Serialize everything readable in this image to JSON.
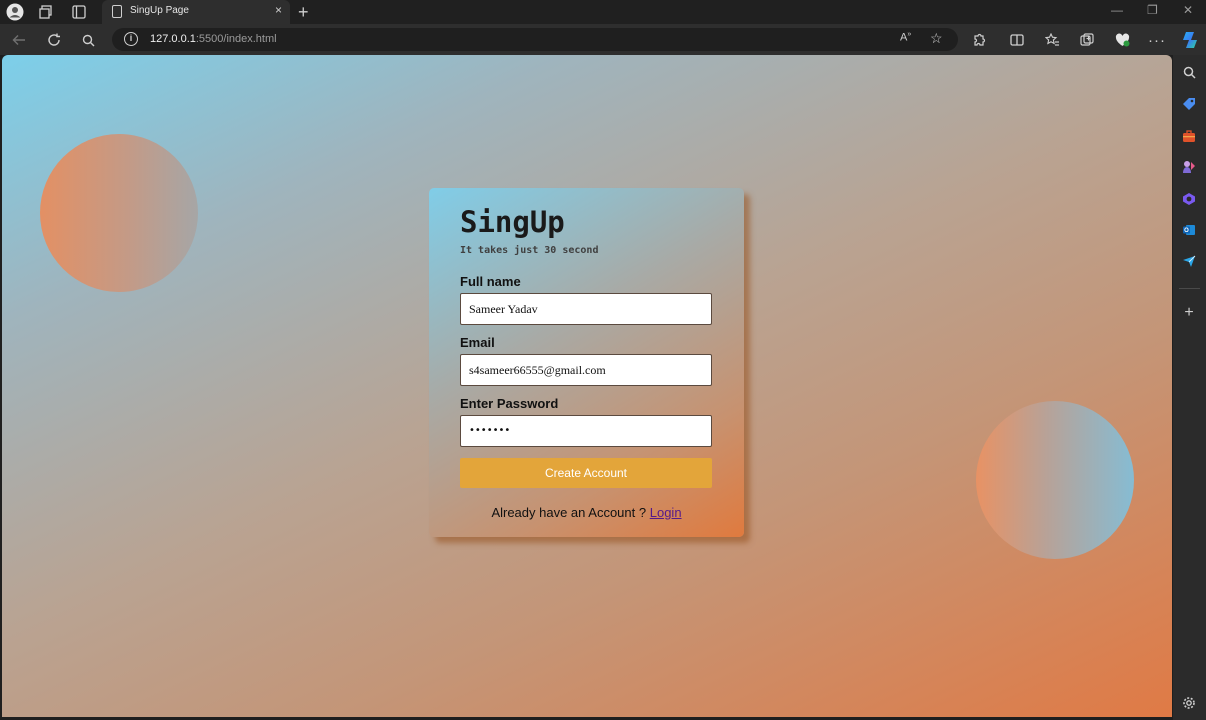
{
  "browser": {
    "tab": {
      "title": "SingUp Page",
      "close": "×"
    },
    "new_tab": "+",
    "window_controls": {
      "minimize": "—",
      "restore": "❐",
      "close": "✕"
    },
    "address": {
      "host": "127.0.0.1",
      "rest": ":5500/index.html"
    },
    "icons": [
      "profile-icon",
      "collections-icon",
      "tab-actions-icon",
      "back-icon",
      "refresh-icon",
      "search-icon",
      "read-aloud-icon",
      "favorite-star-icon",
      "extensions-icon",
      "split-screen-icon",
      "favorites-icon",
      "collections-icon",
      "browser-essentials-icon",
      "more-icon",
      "copilot-icon"
    ]
  },
  "sidebar": {
    "icons": [
      "search-icon",
      "shopping-tag-icon",
      "tools-icon",
      "games-icon",
      "copilot-icon",
      "outlook-icon",
      "send-icon",
      "add-icon",
      "settings-icon"
    ]
  },
  "signup": {
    "title": "SingUp",
    "subtitle": "It takes just 30 second",
    "full_name_label": "Full name",
    "full_name_value": "Sameer Yadav",
    "email_label": "Email",
    "email_value": "s4sameer66555@gmail.com",
    "password_label": "Enter Password",
    "password_value": "•••••••",
    "button": "Create Account",
    "login_prompt": "Already have an Account ?",
    "login_link": "Login"
  },
  "colors": {
    "button": "#e3a53a",
    "gradient_start": "#7ccfea",
    "gradient_end": "#e07a45"
  }
}
